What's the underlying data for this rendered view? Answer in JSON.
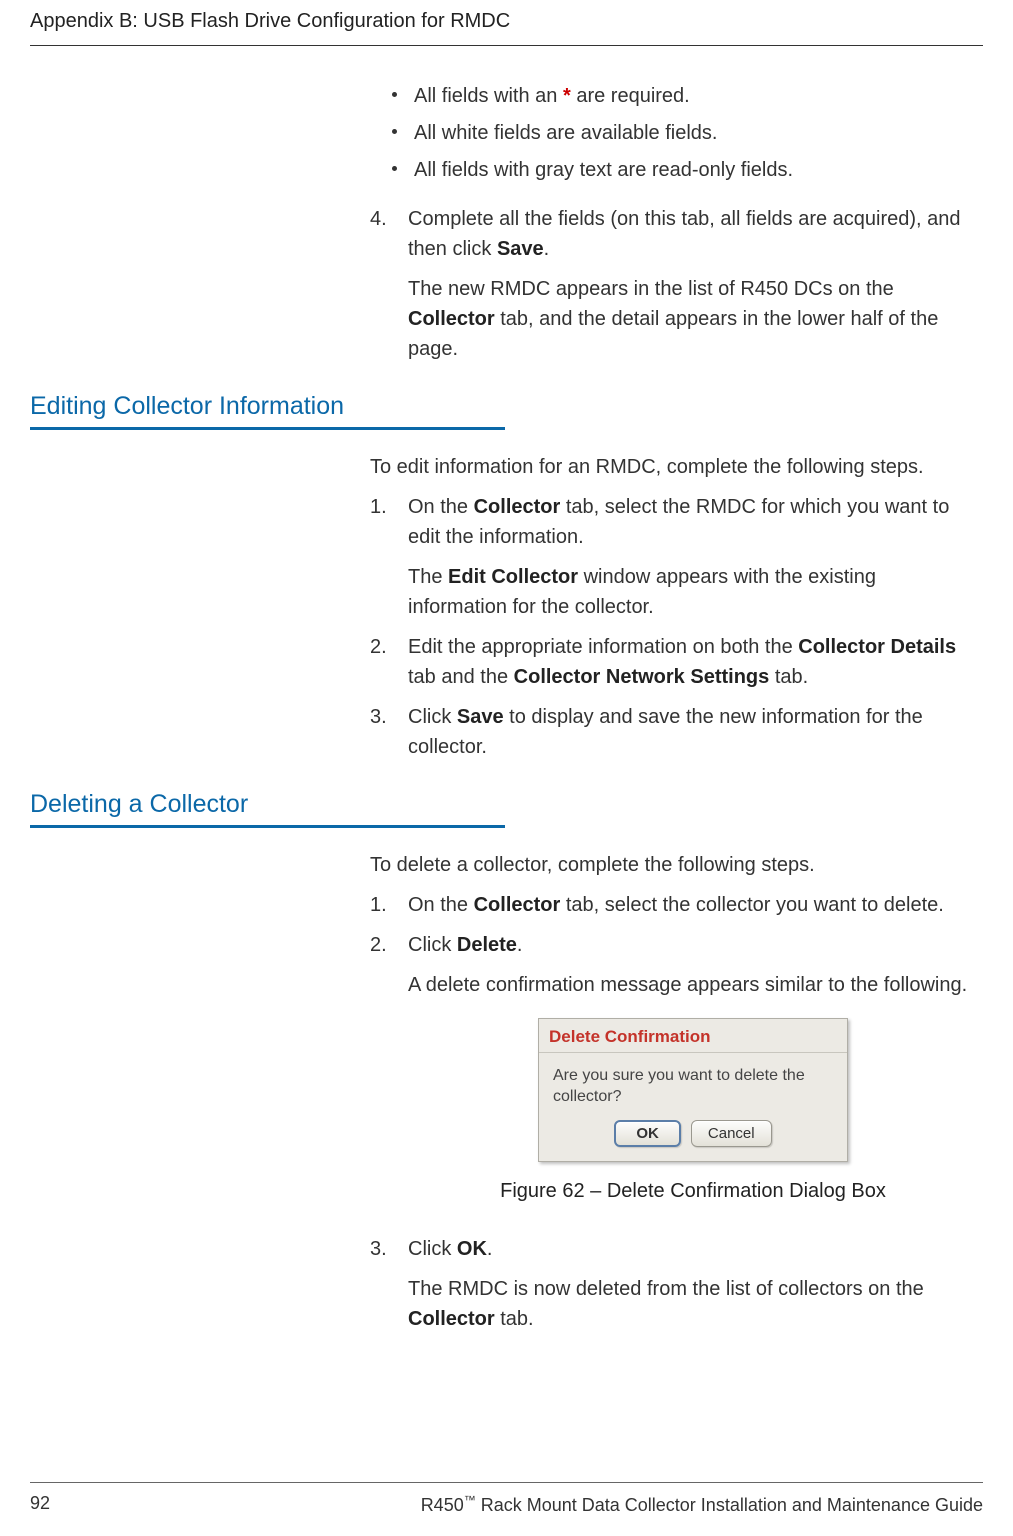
{
  "header": {
    "title": "Appendix B: USB Flash Drive Configuration for RMDC"
  },
  "bullets": {
    "b1_pre": "All fields with an ",
    "b1_ast": "*",
    "b1_post": " are required.",
    "b2": "All white fields are available fields.",
    "b3": "All fields with gray text are read-only fields."
  },
  "step4": {
    "num": " 4.",
    "line1_a": "Complete all the fields (on this tab, all fields are acquired), and then click ",
    "save": "Save",
    "dot": ".",
    "line2_a": "The new RMDC appears in the list of R450 DCs on the ",
    "collector": "Collector",
    "line2_b": " tab, and the detail appears in the lower half of the page."
  },
  "section_edit": {
    "heading": "Editing Collector Information",
    "intro": "To edit information for an RMDC, complete the following steps.",
    "s1": {
      "num": " 1.",
      "a": "On the ",
      "b": "Collector",
      "c": " tab, select the RMDC for which you want to edit the information.",
      "d": "The ",
      "e": "Edit Collector",
      "f": " window appears with the existing information for the collector."
    },
    "s2": {
      "num": " 2.",
      "a": "Edit the appropriate information on both the ",
      "b": "Collector Details",
      "c": " tab and the ",
      "d": "Collector Network Settings",
      "e": " tab."
    },
    "s3": {
      "num": " 3.",
      "a": "Click ",
      "b": "Save",
      "c": " to display and save the new information for the collector."
    }
  },
  "section_delete": {
    "heading": "Deleting a Collector",
    "intro": "To delete a collector, complete the following steps.",
    "s1": {
      "num": " 1.",
      "a": "On the ",
      "b": "Collector",
      "c": " tab, select the collector you want to delete."
    },
    "s2": {
      "num": " 2.",
      "a": "Click ",
      "b": "Delete",
      "dot": ".",
      "c": "A delete confirmation message appears similar to the following."
    },
    "dialog": {
      "title": "Delete Confirmation",
      "body": "Are you sure you want to delete the collector?",
      "ok": "OK",
      "cancel": "Cancel"
    },
    "caption": "Figure 62  –  Delete Confirmation Dialog Box",
    "s3": {
      "num": " 3.",
      "a": "Click ",
      "b": "OK",
      "dot": ".",
      "c1": "The RMDC is now deleted from the list of collectors on the ",
      "c2": "Collector",
      "c3": " tab."
    }
  },
  "footer": {
    "page": "92",
    "book_a": "R450",
    "tm": "™",
    "book_b": " Rack Mount Data Collector Installation and Maintenance Guide"
  }
}
